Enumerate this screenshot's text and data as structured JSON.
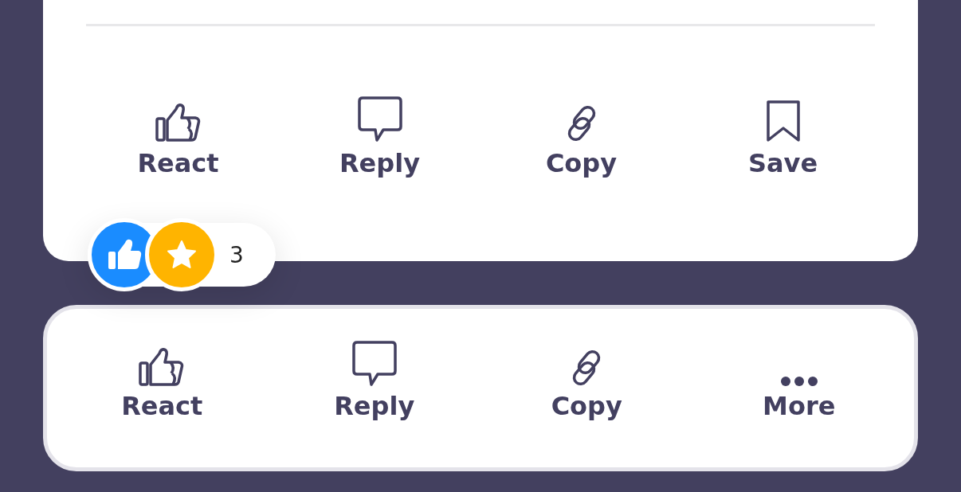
{
  "top_actions": [
    {
      "label": "React",
      "kind": "like"
    },
    {
      "label": "Reply",
      "kind": "reply"
    },
    {
      "label": "Copy",
      "kind": "link"
    },
    {
      "label": "Save",
      "kind": "bookmark"
    }
  ],
  "reactions": {
    "icons": [
      {
        "kind": "like",
        "color": "#1a8cff"
      },
      {
        "kind": "star",
        "color": "#ffb400"
      }
    ],
    "count": "3"
  },
  "bottom_actions": [
    {
      "label": "React",
      "kind": "like"
    },
    {
      "label": "Reply",
      "kind": "reply"
    },
    {
      "label": "Copy",
      "kind": "link"
    },
    {
      "label": "More",
      "kind": "more"
    }
  ]
}
